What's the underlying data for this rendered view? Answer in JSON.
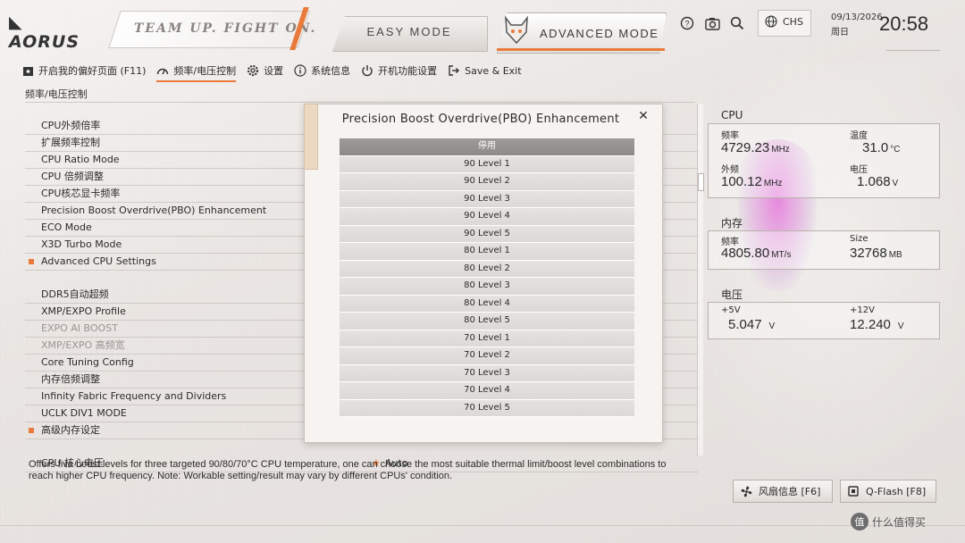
{
  "brand": {
    "logo": "AORUS",
    "slogan": "TEAM UP. FIGHT ON."
  },
  "modes": {
    "easy": "EASY MODE",
    "advanced": "ADVANCED MODE"
  },
  "top": {
    "language": "CHS",
    "date": "09/13/2026",
    "weekday": "周日",
    "time": "20:58"
  },
  "nav": [
    {
      "label": "开启我的偏好页面 (F11)",
      "icon": "favorites-icon"
    },
    {
      "label": "频率/电压控制",
      "icon": "speedometer-icon",
      "active": true
    },
    {
      "label": "设置",
      "icon": "settings-gear-icon"
    },
    {
      "label": "系统信息",
      "icon": "info-icon"
    },
    {
      "label": "开机功能设置",
      "icon": "power-icon"
    },
    {
      "label": "Save & Exit",
      "icon": "exit-icon"
    }
  ],
  "breadcrumb": "频率/电压控制",
  "settings": [
    {
      "label": "CPU外频倍率"
    },
    {
      "label": "扩展频率控制"
    },
    {
      "label": "CPU Ratio Mode"
    },
    {
      "label": "CPU 倍频调整"
    },
    {
      "label": "CPU核芯显卡频率"
    },
    {
      "label": "Precision Boost Overdrive(PBO) Enhancement"
    },
    {
      "label": "ECO Mode"
    },
    {
      "label": "X3D Turbo Mode"
    },
    {
      "label": "Advanced CPU Settings",
      "sub": true
    },
    {
      "label": ""
    },
    {
      "label": "DDR5自动超频"
    },
    {
      "label": "XMP/EXPO Profile"
    },
    {
      "label": "EXPO AI BOOST",
      "dim": true
    },
    {
      "label": "XMP/EXPO 高频宽",
      "dim": true
    },
    {
      "label": "Core Tuning Config"
    },
    {
      "label": "内存倍频调整"
    },
    {
      "label": "Infinity Fabric Frequency and Dividers"
    },
    {
      "label": "UCLK DIV1 MODE"
    },
    {
      "label": "高级内存设定",
      "sub": true
    },
    {
      "label": ""
    },
    {
      "label": "CPU 核心电压",
      "value": "Auto",
      "star": true
    }
  ],
  "help_text": "Offers five boost levels for three targeted 90/80/70°C CPU temperature, one can choose the most suitable thermal limit/boost level combinations to reach higher CPU frequency. Note: Workable setting/result may vary by different CPUs' condition.",
  "cpu_panel": {
    "title": "CPU",
    "freq_label": "频率",
    "freq_value": "4729.23",
    "freq_unit": "MHz",
    "temp_label": "温度",
    "temp_value": "31.0",
    "temp_unit": "°C",
    "bclk_label": "外频",
    "bclk_value": "100.12",
    "bclk_unit": "MHz",
    "volt_label": "电压",
    "volt_value": "1.068",
    "volt_unit": "V"
  },
  "mem_panel": {
    "title": "内存",
    "freq_label": "频率",
    "freq_value": "4805.80",
    "freq_unit": "MT/s",
    "size_label": "Size",
    "size_value": "32768",
    "size_unit": "MB"
  },
  "volt_panel": {
    "title": "电压",
    "v5_label": "+5V",
    "v5_value": "5.047",
    "v5_unit": "V",
    "v12_label": "+12V",
    "v12_value": "12.240",
    "v12_unit": "V"
  },
  "footer": {
    "fan_label": "风扇信息 [F6]",
    "qflash_label": "Q-Flash [F8]"
  },
  "watermark": "什么值得买",
  "modal": {
    "title": "Precision Boost Overdrive(PBO) Enhancement",
    "selected_index": 0,
    "options": [
      "停用",
      "90 Level 1",
      "90 Level 2",
      "90 Level 3",
      "90 Level 4",
      "90 Level 5",
      "80 Level 1",
      "80 Level 2",
      "80 Level 3",
      "80 Level 4",
      "80 Level 5",
      "70 Level 1",
      "70 Level 2",
      "70 Level 3",
      "70 Level 4",
      "70 Level 5"
    ]
  },
  "colors": {
    "accent": "#e97a3b",
    "background": "#e9e5e2",
    "selected": "#9e9a97"
  }
}
